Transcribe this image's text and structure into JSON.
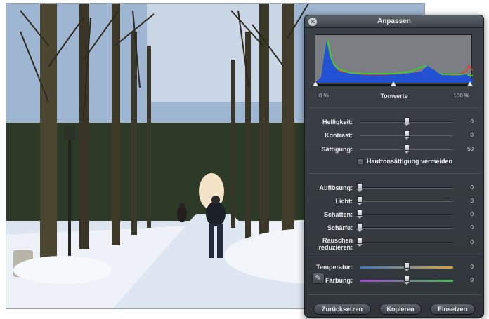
{
  "panel": {
    "title": "Anpassen",
    "close_icon": "close-icon"
  },
  "levels": {
    "title": "Tonwerte",
    "left_label": "0 %",
    "right_label": "100 %"
  },
  "sliders_basic": [
    {
      "label": "Helligkeit:",
      "value": "0",
      "level": 0.5
    },
    {
      "label": "Kontrast:",
      "value": "0",
      "level": 0.5
    },
    {
      "label": "Sättigung:",
      "value": "50",
      "level": 0.5
    }
  ],
  "skin_checkbox": {
    "label": "Hauttonsättigung vermeiden",
    "checked": false
  },
  "sliders_detail": [
    {
      "label": "Auflösung:",
      "value": "0",
      "level": 0.0
    },
    {
      "label": "Licht:",
      "value": "0",
      "level": 0.0
    },
    {
      "label": "Schatten:",
      "value": "0",
      "level": 0.0
    },
    {
      "label": "Schärfe:",
      "value": "0",
      "level": 0.0
    },
    {
      "label": "Rauschen reduzieren:",
      "value": "0",
      "level": 0.0
    }
  ],
  "sliders_color": [
    {
      "label": "Temperatur:",
      "value": "0",
      "level": 0.5,
      "gradient": [
        "#3a78c4",
        "#d8a23a"
      ]
    },
    {
      "label": "Färbung:",
      "value": "0",
      "level": 0.5,
      "gradient": [
        "#a04ac8",
        "#4ab85a"
      ]
    }
  ],
  "eyedropper_icon": "eyedropper-icon",
  "buttons": {
    "reset": "Zurücksetzen",
    "copy": "Kopieren",
    "paste": "Einsetzen"
  },
  "colors": {
    "histogram_blue": "#1e4fd8",
    "histogram_green": "#3fc83a",
    "histogram_red": "#d8463a"
  }
}
